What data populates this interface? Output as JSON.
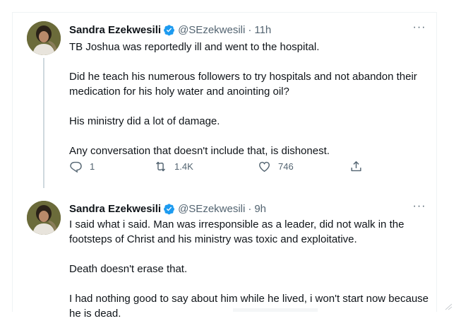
{
  "tweets": [
    {
      "author_name": "Sandra Ezekwesili",
      "handle": "@SEzekwesili",
      "separator": "·",
      "time": "11h",
      "more_label": "···",
      "paragraphs": [
        "TB Joshua was reportedly ill and went to the hospital.",
        "Did he teach his numerous followers to try hospitals and not abandon their medication for his holy water and anointing oil?",
        "His ministry did a lot of damage.",
        "Any conversation that doesn't include that, is dishonest."
      ],
      "reply_count": "1",
      "retweet_count": "1.4K",
      "like_count": "746"
    },
    {
      "author_name": "Sandra Ezekwesili",
      "handle": "@SEzekwesili",
      "separator": "·",
      "time": "9h",
      "more_label": "···",
      "paragraphs": [
        "I said what i said. Man was irresponsible as a leader, did not walk in the footsteps of Christ and his ministry was toxic and exploitative.",
        "Death doesn't erase that.",
        "I had nothing good to say about him while he lived, i won't start now because he is dead."
      ]
    }
  ],
  "colors": {
    "text_primary": "#0f1419",
    "text_secondary": "#536471",
    "verified_blue": "#1d9bf0",
    "thread_line": "#cfd9de"
  },
  "icons": {
    "verified": "verified-badge-icon",
    "more": "more-options-icon",
    "reply": "reply-icon",
    "retweet": "retweet-icon",
    "like": "heart-icon",
    "share": "share-icon"
  }
}
